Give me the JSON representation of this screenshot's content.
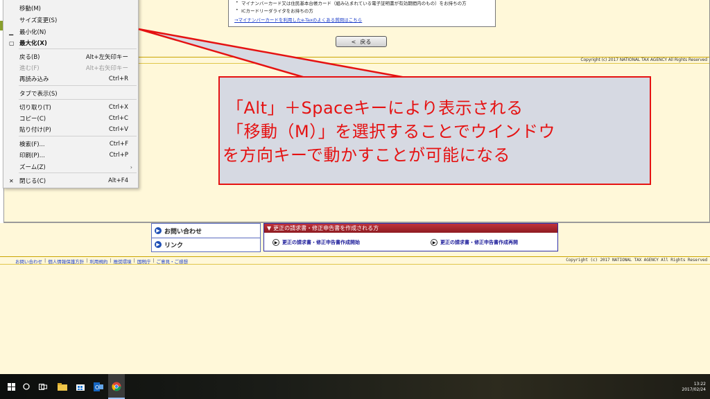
{
  "notice": {
    "item1": "マイナンバーカード又は住民基本台帳カード（組み込まれている電子証明書が有効期間内のもの）をお持ちの方",
    "item2": "ICカードリーダライタをお持ちの方",
    "link": "→マイナンバーカードを利用したe-Taxのよくある質問はこちら"
  },
  "back_button": {
    "arrow": "<",
    "label": "戻る"
  },
  "copyright_top": "Copyright (c) 2017 NATIONAL TAX AGENCY All Rights Reserved",
  "copyright_bottom": "Copyright (c) 2017 NATIONAL TAX AGENCY All Rights Reserved",
  "system_menu": {
    "items": [
      {
        "label": "移動(M)",
        "shortcut": "",
        "glyph": "",
        "disabled": false,
        "bold": false
      },
      {
        "label": "サイズ変更(S)",
        "shortcut": "",
        "glyph": "",
        "disabled": false,
        "bold": false
      },
      {
        "label": "最小化(N)",
        "shortcut": "",
        "glyph": "▁",
        "disabled": false,
        "bold": false
      },
      {
        "label": "最大化(X)",
        "shortcut": "",
        "glyph": "▢",
        "disabled": false,
        "bold": true
      },
      {
        "label": "戻る(B)",
        "shortcut": "Alt+左矢印キー",
        "glyph": "",
        "disabled": false,
        "bold": false
      },
      {
        "label": "進む(F)",
        "shortcut": "Alt+右矢印キー",
        "glyph": "",
        "disabled": true,
        "bold": false
      },
      {
        "label": "再読み込み",
        "shortcut": "Ctrl+R",
        "glyph": "",
        "disabled": false,
        "bold": false
      },
      {
        "label": "タブで表示(S)",
        "shortcut": "",
        "glyph": "",
        "disabled": false,
        "bold": false
      },
      {
        "label": "切り取り(T)",
        "shortcut": "Ctrl+X",
        "glyph": "",
        "disabled": false,
        "bold": false
      },
      {
        "label": "コピー(C)",
        "shortcut": "Ctrl+C",
        "glyph": "",
        "disabled": false,
        "bold": false
      },
      {
        "label": "貼り付け(P)",
        "shortcut": "Ctrl+V",
        "glyph": "",
        "disabled": false,
        "bold": false
      },
      {
        "label": "検索(F)...",
        "shortcut": "Ctrl+F",
        "glyph": "",
        "disabled": false,
        "bold": false
      },
      {
        "label": "印刷(P)...",
        "shortcut": "Ctrl+P",
        "glyph": "",
        "disabled": false,
        "bold": false
      },
      {
        "label": "ズーム(Z)",
        "shortcut": "",
        "glyph": "",
        "disabled": false,
        "bold": false
      },
      {
        "label": "閉じる(C)",
        "shortcut": "Alt+F4",
        "glyph": "✕",
        "disabled": false,
        "bold": false
      }
    ],
    "submenu_arrow": "›"
  },
  "callout": {
    "line1": "「Alt」＋Spaceキーにより表示される",
    "line2": "「移動（M）」を選択することでウインドウ",
    "line3": "を方向キーで動かすことが可能になる",
    "border_color": "#e51212",
    "fill_color": "#d6d9e2"
  },
  "left_menu": {
    "contact": "お問い合わせ",
    "links": "リンク"
  },
  "correction_panel": {
    "header": "更正の請求書・修正申告書を作成される方",
    "start_link": "更正の請求書・修正申告書作成開始",
    "resume_link": "更正の請求書・修正申告書作成再開"
  },
  "footer": {
    "links": [
      "お問い合わせ",
      "個人情報保護方針",
      "利用規約",
      "推奨環境",
      "国税庁",
      "ご意見・ご感想"
    ]
  },
  "taskbar": {
    "icons": [
      "windows-start-icon",
      "cortana-circle-icon",
      "task-view-icon",
      "file-explorer-icon",
      "store-icon",
      "outlook-icon",
      "chrome-icon"
    ],
    "time": "13:22",
    "date": "2017/02/24"
  },
  "colors": {
    "page_background": "#fff8d9",
    "accent_red": "#e51212",
    "header_red": "#a8232b",
    "link_blue": "#1a3cc8"
  }
}
